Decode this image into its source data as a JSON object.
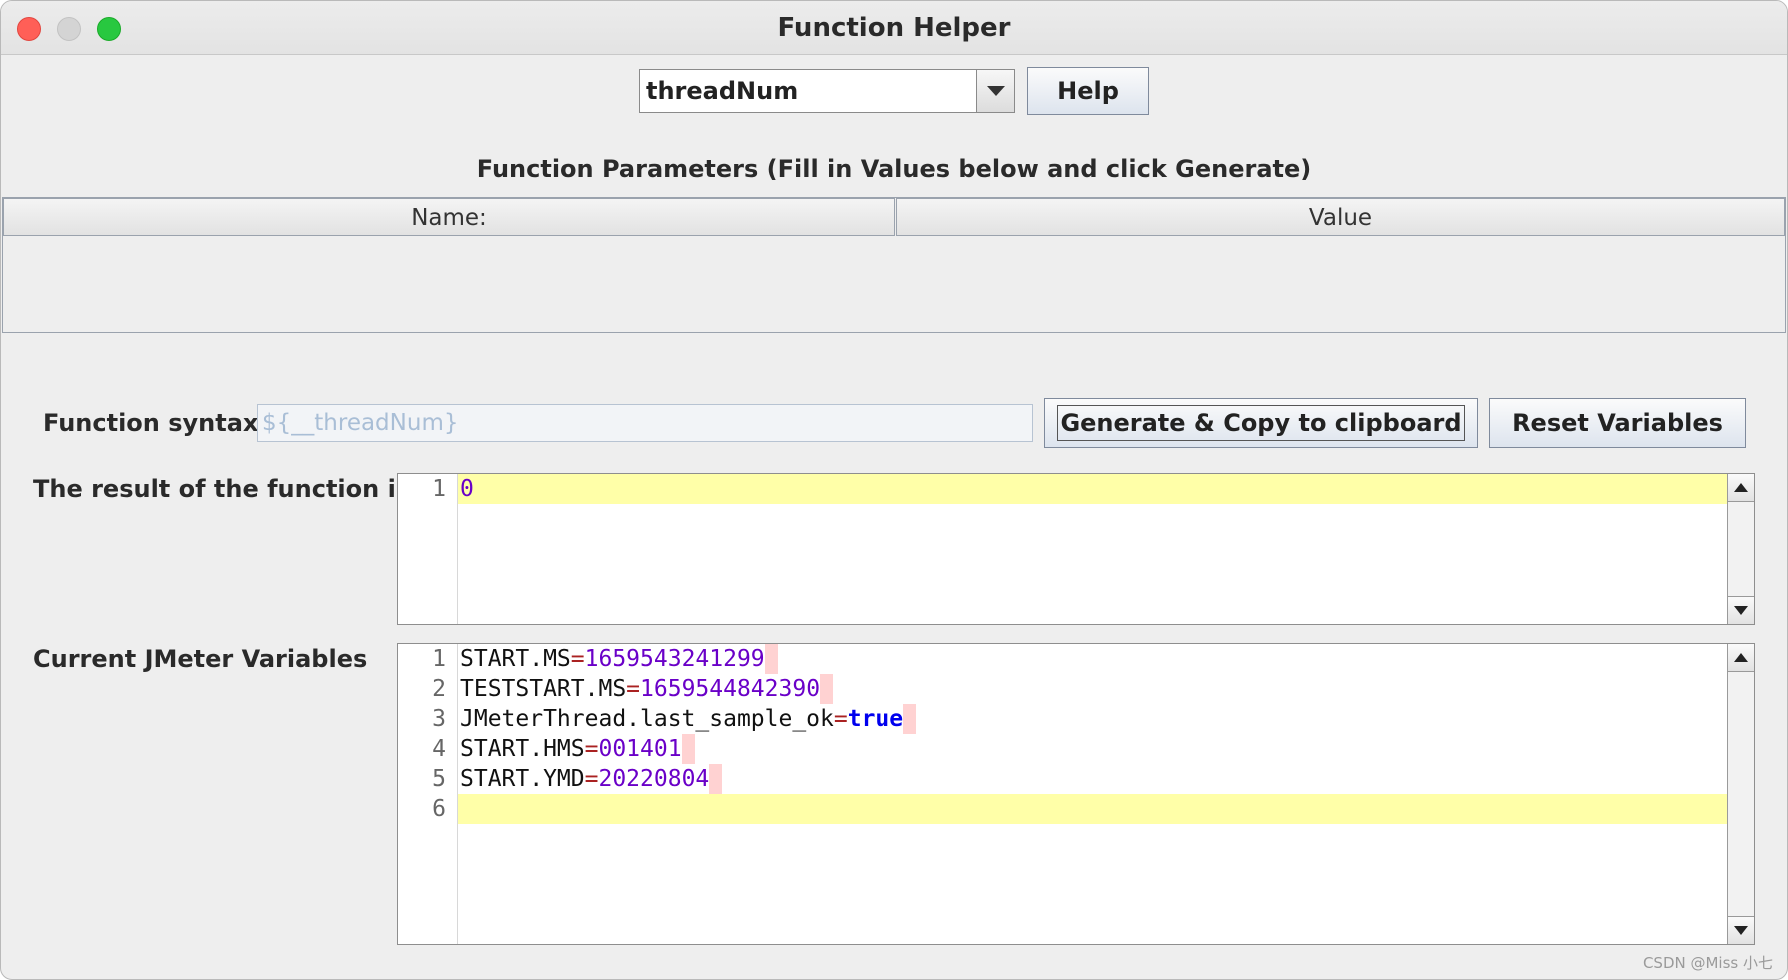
{
  "window": {
    "title": "Function Helper"
  },
  "toolbar": {
    "selected_function": "threadNum",
    "help_label": "Help"
  },
  "parameters": {
    "title": "Function Parameters (Fill in Values below and click Generate)",
    "columns": [
      "Name:",
      "Value"
    ]
  },
  "syntax": {
    "label": "Function syntax:",
    "value": "${__threadNum}",
    "generate_label": "Generate & Copy to clipboard",
    "reset_label": "Reset Variables"
  },
  "result": {
    "label": "The result of the function is",
    "lines": [
      {
        "number": "1",
        "text": "0"
      }
    ]
  },
  "variables": {
    "label": "Current JMeter Variables",
    "lines": [
      {
        "number": "1",
        "key": "START.MS",
        "value": "1659543241299"
      },
      {
        "number": "2",
        "key": "TESTSTART.MS",
        "value": "1659544842390"
      },
      {
        "number": "3",
        "key": "JMeterThread.last_sample_ok",
        "value": "true"
      },
      {
        "number": "4",
        "key": "START.HMS",
        "value": "001401"
      },
      {
        "number": "5",
        "key": "START.YMD",
        "value": "20220804"
      },
      {
        "number": "6",
        "key": "",
        "value": ""
      }
    ],
    "equals": "="
  },
  "watermark": "CSDN @Miss 小七",
  "colors": {
    "current_line": "#ffffa8",
    "value_purple": "#6a00c8",
    "bool_blue": "#0000ee",
    "trailing_space": "#ffd2d2"
  }
}
